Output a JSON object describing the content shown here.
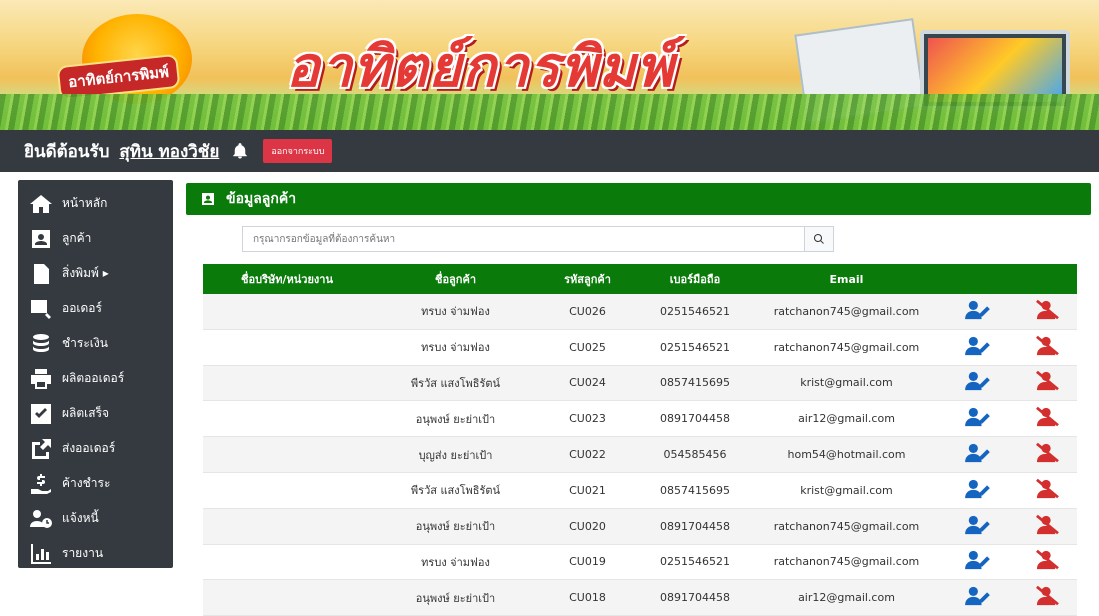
{
  "banner": {
    "logo_text": "อาทิตย์การพิมพ์",
    "title": "อาทิตย์การพิมพ์"
  },
  "topbar": {
    "welcome": "ยินดีต้อนรับ",
    "username": "สุทิน ทองวิชัย",
    "logout_label": "ออกจากระบบ"
  },
  "sidebar": {
    "items": [
      {
        "label": "หน้าหลัก",
        "icon": "home-icon"
      },
      {
        "label": "ลูกค้า",
        "icon": "customer-card-icon"
      },
      {
        "label": "สิ่งพิมพ์ ▸",
        "icon": "document-icon"
      },
      {
        "label": "ออเดอร์",
        "icon": "order-chart-icon"
      },
      {
        "label": "ชำระเงิน",
        "icon": "coins-icon"
      },
      {
        "label": "ผลิตออเดอร์",
        "icon": "printer-icon"
      },
      {
        "label": "ผลิตเสร็จ",
        "icon": "check-icon"
      },
      {
        "label": "ส่งออเดอร์",
        "icon": "share-icon"
      },
      {
        "label": "ค้างชำระ",
        "icon": "money-hand-icon"
      },
      {
        "label": "แจ้งหนี้",
        "icon": "user-clock-icon"
      },
      {
        "label": "รายงาน",
        "icon": "bar-chart-icon"
      }
    ]
  },
  "panel": {
    "title": "ข้อมูลลูกค้า",
    "search_placeholder": "กรุณากรอกข้อมูลที่ต้องการค้นหา"
  },
  "table": {
    "headers": [
      "ชื่อบริษัท/หน่วยงาน",
      "ชื่อลูกค้า",
      "รหัสลูกค้า",
      "เบอร์มือถือ",
      "Email"
    ],
    "rows": [
      {
        "company": "",
        "name": "ทรบง จ่ามฟอง",
        "id": "CU026",
        "phone": "0251546521",
        "email": "ratchanon745@gmail.com"
      },
      {
        "company": "",
        "name": "ทรบง จ่ามฟอง",
        "id": "CU025",
        "phone": "0251546521",
        "email": "ratchanon745@gmail.com"
      },
      {
        "company": "",
        "name": "พีรวัส แสงโพธิรัตน์",
        "id": "CU024",
        "phone": "0857415695",
        "email": "krist@gmail.com"
      },
      {
        "company": "",
        "name": "อนุพงษ์ ยะย่าเป้า",
        "id": "CU023",
        "phone": "0891704458",
        "email": "air12@gmail.com"
      },
      {
        "company": "",
        "name": "บุญส่ง ยะย่าเป้า",
        "id": "CU022",
        "phone": "054585456",
        "email": "hom54@hotmail.com"
      },
      {
        "company": "",
        "name": "พีรวัส แสงโพธิรัตน์",
        "id": "CU021",
        "phone": "0857415695",
        "email": "krist@gmail.com"
      },
      {
        "company": "",
        "name": "อนุพงษ์ ยะย่าเป้า",
        "id": "CU020",
        "phone": "0891704458",
        "email": "ratchanon745@gmail.com"
      },
      {
        "company": "",
        "name": "ทรบง จ่ามฟอง",
        "id": "CU019",
        "phone": "0251546521",
        "email": "ratchanon745@gmail.com"
      },
      {
        "company": "",
        "name": "อนุพงษ์ ยะย่าเป้า",
        "id": "CU018",
        "phone": "0891704458",
        "email": "air12@gmail.com"
      }
    ]
  },
  "colors": {
    "green_accent": "#0a7a0a",
    "dark_bar": "#343a40",
    "logout_red": "#dc3545",
    "edit_blue": "#1565c0",
    "delete_red": "#d32f2f"
  }
}
